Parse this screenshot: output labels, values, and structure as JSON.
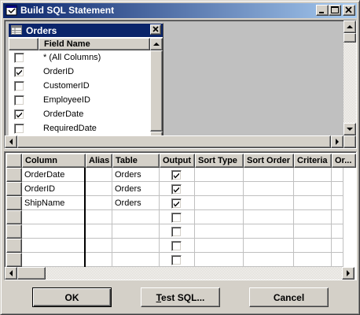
{
  "window": {
    "title": "Build SQL Statement",
    "icons": {
      "app": "sql-window-icon",
      "minimize": "minimize-icon",
      "maximize": "maximize-icon",
      "close": "close-icon"
    }
  },
  "table_box": {
    "name": "Orders",
    "icon": "table-icon",
    "header": "Field Name",
    "fields": [
      {
        "label": "* (All Columns)",
        "checked": false
      },
      {
        "label": "OrderID",
        "checked": true
      },
      {
        "label": "CustomerID",
        "checked": false
      },
      {
        "label": "EmployeeID",
        "checked": false
      },
      {
        "label": "OrderDate",
        "checked": true
      },
      {
        "label": "RequiredDate",
        "checked": false
      }
    ]
  },
  "grid": {
    "columns": [
      "Column",
      "Alias",
      "Table",
      "Output",
      "Sort Type",
      "Sort Order",
      "Criteria",
      "Or..."
    ],
    "rows": [
      {
        "column": "OrderDate",
        "alias": "",
        "table": "Orders",
        "output": true
      },
      {
        "column": "OrderID",
        "alias": "",
        "table": "Orders",
        "output": true
      },
      {
        "column": "ShipName",
        "alias": "",
        "table": "Orders",
        "output": true
      },
      {
        "column": "",
        "alias": "",
        "table": "",
        "output": false
      },
      {
        "column": "",
        "alias": "",
        "table": "",
        "output": false
      },
      {
        "column": "",
        "alias": "",
        "table": "",
        "output": false
      },
      {
        "column": "",
        "alias": "",
        "table": "",
        "output": false
      }
    ]
  },
  "buttons": {
    "ok": "OK",
    "test_sql_prefix": "",
    "test_sql_accel": "T",
    "test_sql_rest": "est SQL...",
    "cancel": "Cancel"
  },
  "colors": {
    "title_start": "#0a246a",
    "title_end": "#a6caf0",
    "face": "#d4d0c8"
  }
}
